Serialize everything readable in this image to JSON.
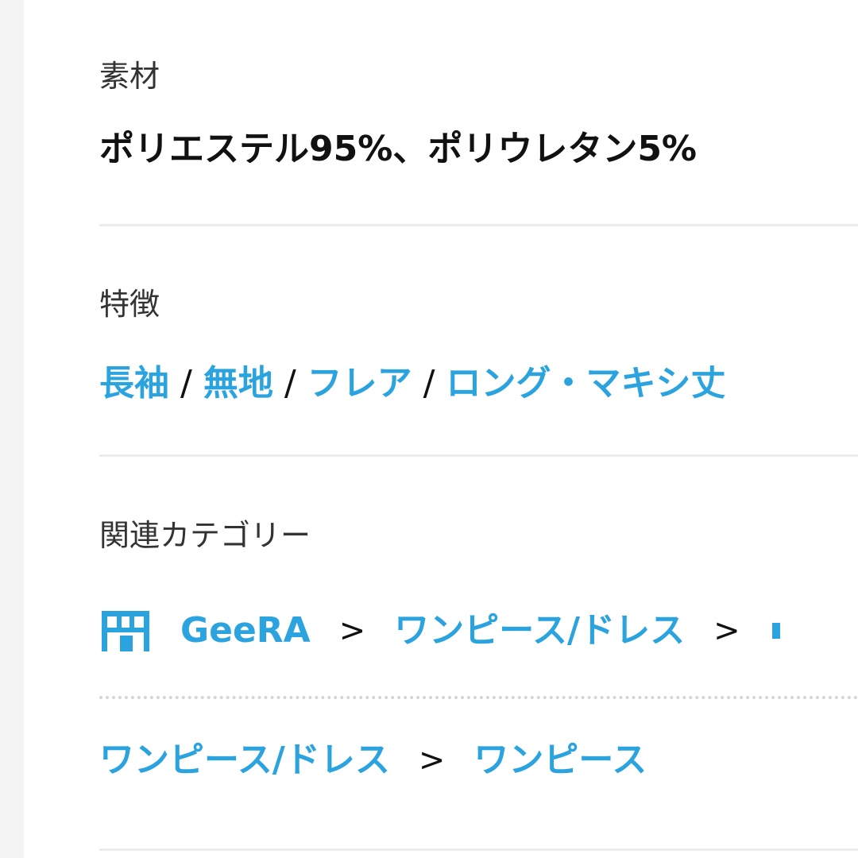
{
  "material": {
    "label": "素材",
    "value": "ポリエステル95%、ポリウレタン5%"
  },
  "features": {
    "label": "特徴",
    "items": [
      "長袖",
      "無地",
      "フレア",
      "ロング・マキシ丈"
    ],
    "separator": "/"
  },
  "related_categories": {
    "label": "関連カテゴリー",
    "rows": [
      {
        "crumbs": [
          "GeeRA",
          "ワンピース/ドレス"
        ],
        "separator": ">"
      },
      {
        "crumbs": [
          "ワンピース/ドレス",
          "ワンピース"
        ],
        "separator": ">"
      }
    ]
  },
  "colors": {
    "link": "#2aa3df",
    "text": "#111111",
    "label": "#333333",
    "divider": "#ececec",
    "gutter": "#f4f4f4"
  },
  "icons": {
    "shop": "shop-icon"
  }
}
